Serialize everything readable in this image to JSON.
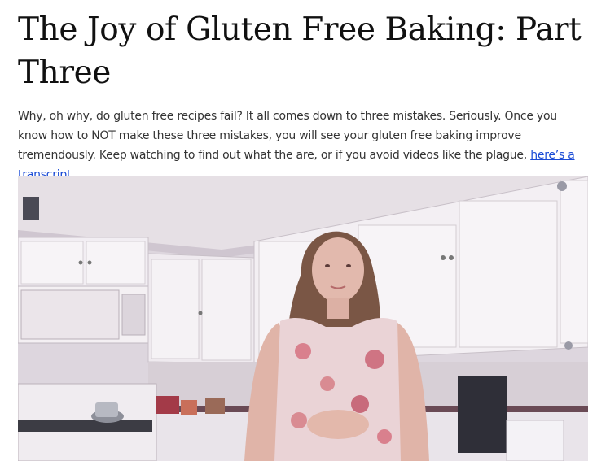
{
  "post": {
    "title": "The Joy of Gluten Free Baking: Part Three",
    "intro_text": "Why, oh why, do gluten free recipes fail? It all comes down to three mistakes. Seriously. Once you know how to NOT make these three mistakes, you will see your gluten free baking improve tremendously. Keep watching to find out what the are, or if you avoid videos like the plague, ",
    "transcript_link": "here’s a transcript",
    "intro_end": "."
  },
  "colors": {
    "link": "#1a4bd6",
    "title": "#111111",
    "body_text": "#333333"
  }
}
